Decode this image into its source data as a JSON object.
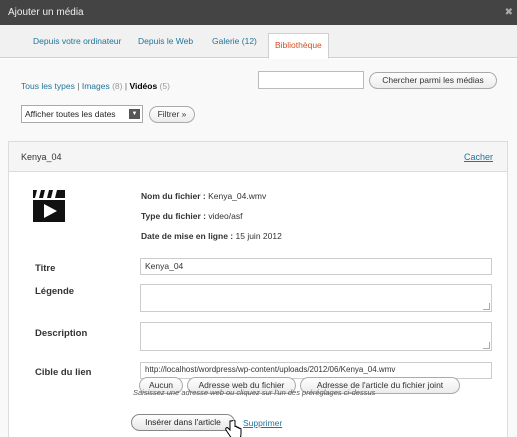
{
  "dialog": {
    "title": "Ajouter un média"
  },
  "tabs": [
    {
      "label": "Depuis votre ordinateur"
    },
    {
      "label": "Depuis le Web"
    },
    {
      "label": "Galerie (12)"
    },
    {
      "label": "Bibliothèque"
    }
  ],
  "filters": {
    "all_label": "Tous les types",
    "images_label": "Images",
    "images_count": "(8)",
    "videos_label": "Vidéos",
    "videos_count": "(5)",
    "separator": "|"
  },
  "search": {
    "value": "",
    "button_label": "Chercher parmi les médias"
  },
  "date_filter": {
    "selected": "Afficher toutes les dates",
    "button_label": "Filtrer »"
  },
  "item": {
    "title": "Kenya_04",
    "hide_label": "Cacher",
    "icon": "video-clapper-icon",
    "file_name_label": "Nom du fichier :",
    "file_name": "Kenya_04.wmv",
    "file_type_label": "Type du fichier :",
    "file_type": "video/asf",
    "upload_date_label": "Date de mise en ligne :",
    "upload_date": "15 juin 2012"
  },
  "form": {
    "title_label": "Titre",
    "title_value": "Kenya_04",
    "caption_label": "Légende",
    "caption_value": "",
    "description_label": "Description",
    "description_value": "",
    "link_label": "Cible du lien",
    "link_value": "http://localhost/wordpress/wp-content/uploads/2012/06/Kenya_04.wmv",
    "btn_none": "Aucun",
    "btn_file_url": "Adresse web du fichier",
    "btn_post_url": "Adresse de l'article du fichier joint",
    "help_text": "Saisissez une adresse web ou cliquez sur l'un des préréglages ci-dessus",
    "insert_label": "Insérer dans l'article",
    "delete_label": "Supprimer"
  }
}
